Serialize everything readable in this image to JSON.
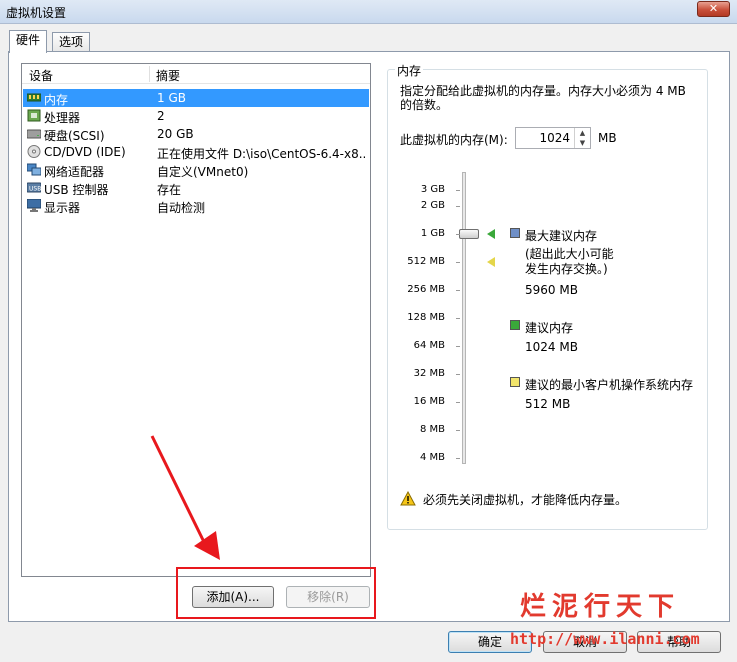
{
  "window": {
    "title": "虚拟机设置",
    "close_label": "✕"
  },
  "tabs": [
    {
      "label": "硬件"
    },
    {
      "label": "选项"
    }
  ],
  "device_list": {
    "col_device": "设备",
    "col_summary": "摘要",
    "rows": [
      {
        "name": "内存",
        "summary": "1 GB",
        "icon": "memory-icon"
      },
      {
        "name": "处理器",
        "summary": "2",
        "icon": "processor-icon"
      },
      {
        "name": "硬盘(SCSI)",
        "summary": "20 GB",
        "icon": "hard-disk-icon"
      },
      {
        "name": "CD/DVD (IDE)",
        "summary": "正在使用文件 D:\\iso\\CentOS-6.4-x8...",
        "icon": "cd-dvd-icon"
      },
      {
        "name": "网络适配器",
        "summary": "自定义(VMnet0)",
        "icon": "network-adapter-icon"
      },
      {
        "name": "USB 控制器",
        "summary": "存在",
        "icon": "usb-controller-icon"
      },
      {
        "name": "显示器",
        "summary": "自动检测",
        "icon": "display-icon"
      }
    ],
    "selected_index": 0
  },
  "buttons": {
    "add": "添加(A)...",
    "remove": "移除(R)",
    "ok": "确定",
    "cancel": "取消",
    "help": "帮助"
  },
  "memory": {
    "legend": "内存",
    "description": "指定分配给此虚拟机的内存量。内存大小必须为 4 MB 的倍数。",
    "field_label": "此虚拟机的内存(M):",
    "value": "1024",
    "unit": "MB",
    "scale_labels": [
      "3 GB",
      "2 GB",
      "1 GB",
      "512 MB",
      "256 MB",
      "128 MB",
      "64 MB",
      "32 MB",
      "16 MB",
      "8 MB",
      "4 MB"
    ],
    "max_recommended_label": "最大建议内存",
    "max_recommended_note": "(超出此大小可能发生内存交换。)",
    "max_recommended_value": "5960 MB",
    "recommended_label": "建议内存",
    "recommended_value": "1024 MB",
    "min_guest_label": "建议的最小客户机操作系统内存",
    "min_guest_value": "512 MB",
    "warning": "必须先关闭虚拟机，才能降低内存量。",
    "colors": {
      "max": "#6f8fc7",
      "recommended": "#3aa83a",
      "min": "#f2e56b"
    }
  },
  "watermark": {
    "text": "烂泥行天下",
    "url": "http://www.ilanni.com"
  }
}
